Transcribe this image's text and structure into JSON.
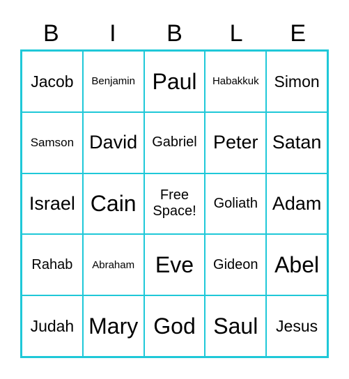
{
  "header": [
    "B",
    "I",
    "B",
    "L",
    "E"
  ],
  "cells": [
    {
      "text": "Jacob",
      "size": "s-m"
    },
    {
      "text": "Benjamin",
      "size": "s-xs"
    },
    {
      "text": "Paul",
      "size": "s-xl"
    },
    {
      "text": "Habakkuk",
      "size": "s-xs"
    },
    {
      "text": "Simon",
      "size": "s-m"
    },
    {
      "text": "Samson",
      "size": "s-s"
    },
    {
      "text": "David",
      "size": "s-l"
    },
    {
      "text": "Gabriel",
      "size": "s-sm"
    },
    {
      "text": "Peter",
      "size": "s-l"
    },
    {
      "text": "Satan",
      "size": "s-l"
    },
    {
      "text": "Israel",
      "size": "s-l"
    },
    {
      "text": "Cain",
      "size": "s-xl"
    },
    {
      "text": "Free Space!",
      "size": "s-sm"
    },
    {
      "text": "Goliath",
      "size": "s-sm"
    },
    {
      "text": "Adam",
      "size": "s-l"
    },
    {
      "text": "Rahab",
      "size": "s-sm"
    },
    {
      "text": "Abraham",
      "size": "s-xs"
    },
    {
      "text": "Eve",
      "size": "s-xl"
    },
    {
      "text": "Gideon",
      "size": "s-sm"
    },
    {
      "text": "Abel",
      "size": "s-xl"
    },
    {
      "text": "Judah",
      "size": "s-m"
    },
    {
      "text": "Mary",
      "size": "s-xl"
    },
    {
      "text": "God",
      "size": "s-xl"
    },
    {
      "text": "Saul",
      "size": "s-xl"
    },
    {
      "text": "Jesus",
      "size": "s-m"
    }
  ],
  "colors": {
    "grid_border": "#1fc8d8",
    "text": "#000000",
    "background": "#ffffff"
  }
}
